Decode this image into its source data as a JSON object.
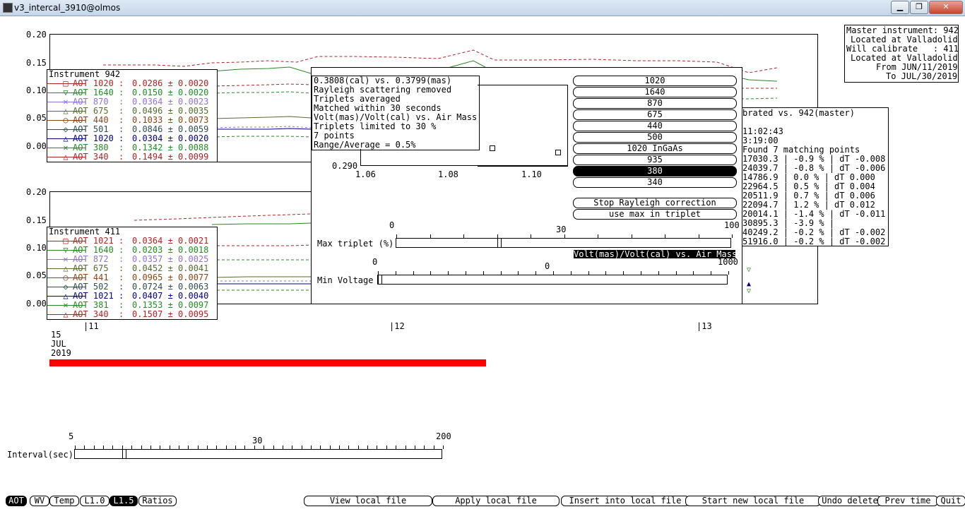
{
  "window": {
    "title": "v3_intercal_3910@olmos",
    "minimize": "▁",
    "maximize": "❐",
    "close": "✕"
  },
  "plot1": {
    "yticks": [
      "0.20",
      "0.15",
      "0.10",
      "0.05",
      "0.00"
    ],
    "legend_title": "Instrument 942",
    "rows": [
      {
        "label": "AOT 1020 :",
        "value": "0.0286 ± 0.0020",
        "color": "#b22222",
        "marker": "□"
      },
      {
        "label": "AOT 1640 :",
        "value": "0.0150 ± 0.0020",
        "color": "#228b22",
        "marker": "▽"
      },
      {
        "label": "AOT 870  :",
        "value": "0.0364 ± 0.0023",
        "color": "#9370db",
        "marker": "✕"
      },
      {
        "label": "AOT 675  :",
        "value": "0.0496 ± 0.0035",
        "color": "#556b2f",
        "marker": "△"
      },
      {
        "label": "AOT 440  :",
        "value": "0.1033 ± 0.0073",
        "color": "#8b4513",
        "marker": "○"
      },
      {
        "label": "AOT 501  :",
        "value": "0.0846 ± 0.0059",
        "color": "#2f4f4f",
        "marker": "◇"
      },
      {
        "label": "AOT 1020 :",
        "value": "0.0304 ± 0.0020",
        "color": "#00008b",
        "marker": "△"
      },
      {
        "label": "AOT 380  :",
        "value": "0.1342 ± 0.0088",
        "color": "#228b22",
        "marker": "✕"
      },
      {
        "label": "AOT 340  :",
        "value": "0.1494 ± 0.0099",
        "color": "#b22222",
        "marker": "△"
      }
    ]
  },
  "plot2": {
    "yticks": [
      "0.20",
      "0.15",
      "0.10",
      "0.05",
      "0.00"
    ],
    "legend_title": "Instrument 411",
    "rows": [
      {
        "label": "AOT 1021 :",
        "value": "0.0364 ± 0.0021",
        "color": "#b22222",
        "marker": "□"
      },
      {
        "label": "AOT 1640 :",
        "value": "0.0203 ± 0.0018",
        "color": "#228b22",
        "marker": "▽"
      },
      {
        "label": "AOT 872  :",
        "value": "0.0357 ± 0.0025",
        "color": "#9370db",
        "marker": "✕"
      },
      {
        "label": "AOT 675  :",
        "value": "0.0452 ± 0.0041",
        "color": "#556b2f",
        "marker": "△"
      },
      {
        "label": "AOT 441  :",
        "value": "0.0965 ± 0.0077",
        "color": "#8b4513",
        "marker": "○"
      },
      {
        "label": "AOT 502  :",
        "value": "0.0724 ± 0.0063",
        "color": "#2f4f4f",
        "marker": "◇"
      },
      {
        "label": "AOT 1021 :",
        "value": "0.0407 ± 0.0040",
        "color": "#00008b",
        "marker": "△"
      },
      {
        "label": "AOT 381  :",
        "value": "0.1353 ± 0.0097",
        "color": "#228b22",
        "marker": "✕"
      },
      {
        "label": "AOT 340  :",
        "value": "0.1507 ± 0.0095",
        "color": "#b22222",
        "marker": "△"
      }
    ]
  },
  "xaxis": {
    "labels": [
      "11",
      "12",
      "13"
    ],
    "date": [
      "15",
      "JUL",
      "2019"
    ]
  },
  "masterinfo": [
    "Master instrument: 942",
    "Located at Valladolid",
    "Will calibrate   : 411",
    "Located at Valladolid",
    "From JUN/11/2019",
    "To JUL/30/2019"
  ],
  "calpanel": {
    "title": "brated vs. 942(master)",
    "lines": [
      "",
      "11:02:43",
      "3:19:00",
      "Found 7 matching points",
      "17030.3 | -0.9 % | dT -0.008",
      "24039.7 | -0.8 % | dT -0.006",
      "14786.9 | 0.0 % | dT 0.000",
      "22964.5 | 0.5 % | dT 0.004",
      "20511.9 | 0.7 % | dT 0.006",
      "22094.7 | 1.2 % | dT 0.012",
      "20014.1 | -1.4 % | dT -0.011",
      "30895.3 | -3.9 % |",
      "40249.2 | -0.2 % | dT -0.002",
      "51916.0 | -0.2 % | dT -0.002"
    ]
  },
  "popup": {
    "info": [
      "0.3808(cal) vs. 0.3799(mas)",
      "Rayleigh scattering removed",
      "Triplets averaged",
      "Matched within 30 seconds",
      "Volt(mas)/Volt(cal) vs. Air Mass",
      "Triplets limited to 30 %",
      "7 points",
      "Range/Average = 0.5%"
    ],
    "ylabel_bottom": "0.290",
    "xticks": [
      "1.06",
      "1.08",
      "1.10"
    ],
    "wavelengths": [
      "1020",
      "1640",
      "870",
      "675",
      "440",
      "500",
      "1020 InGaAs",
      "935",
      "380",
      "340"
    ],
    "selected_wavelength": "380",
    "rayleigh_button": "Stop Rayleigh correction",
    "triplet_button": "use max in triplet",
    "mode_label": "Volt(mas)/Volt(cal) vs. Air Mass",
    "max_triplet": {
      "label": "Max triplet (%)",
      "min": "0",
      "mid": "30",
      "max": "100",
      "value": 30
    },
    "min_voltage": {
      "label": "Min Voltage",
      "min": "0",
      "mid": "0",
      "max": "1000",
      "value": 0
    }
  },
  "interval": {
    "label": "Interval(sec)",
    "min": "5",
    "mid": "30",
    "max": "200",
    "value": 30
  },
  "bottom_tabs": [
    {
      "label": "AOT",
      "selected": true
    },
    {
      "label": "WV",
      "selected": false
    },
    {
      "label": "Temp",
      "selected": false
    },
    {
      "label": "L1.0",
      "selected": false
    },
    {
      "label": "L1.5",
      "selected": true
    },
    {
      "label": "Ratios",
      "selected": false
    }
  ],
  "actions": [
    "View local file",
    "Apply local file",
    "Insert into local file",
    "Start new local file",
    "Undo delete",
    "Prev time",
    "Quit"
  ]
}
